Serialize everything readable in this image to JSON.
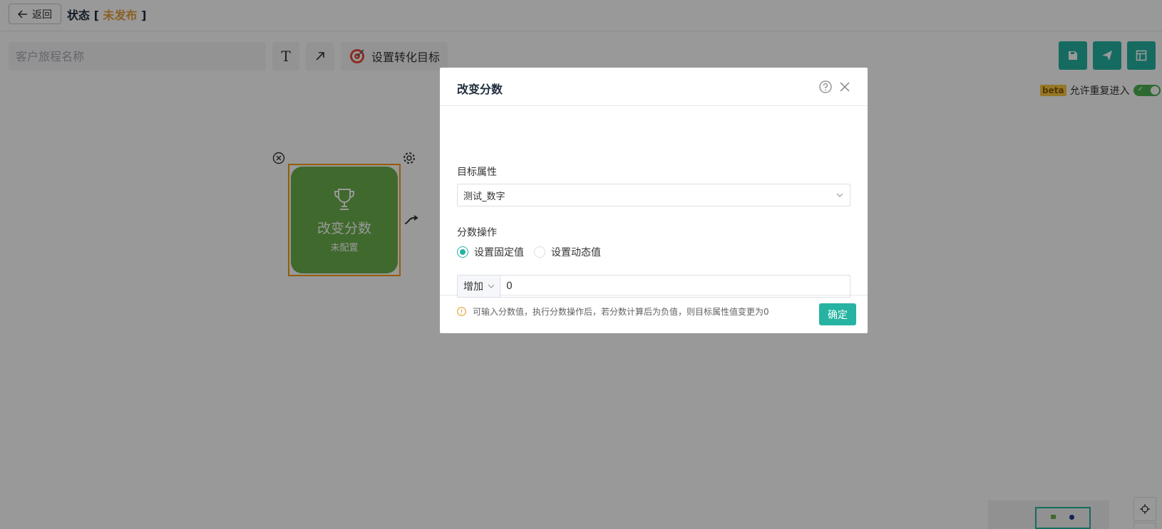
{
  "header": {
    "back_label": "返回",
    "status_prefix": "状态 [",
    "status_value": "未发布",
    "status_suffix": "]"
  },
  "toolbar": {
    "name_placeholder": "客户旅程名称",
    "text_tool_glyph": "T",
    "goal_label": "设置转化目标"
  },
  "settings": {
    "beta_label": "beta",
    "allow_reentry_label": "允许重复进入",
    "allow_reentry_enabled": true
  },
  "node": {
    "title": "改变分数",
    "subtitle": "未配置"
  },
  "dialog": {
    "title": "改变分数",
    "attr_label": "目标属性",
    "attr_value": "测试_数字",
    "op_label": "分数操作",
    "radio_fixed": "设置固定值",
    "radio_dynamic": "设置动态值",
    "selected_radio": "fixed",
    "op_select_value": "增加",
    "score_value": "0",
    "hint": "可输入分数值，执行分数操作后，若分数计算后为负值，则目标属性值变更为0",
    "ok_label": "确定"
  },
  "colors": {
    "accent": "#26b3a2",
    "warning": "#e6a23c",
    "node_fill": "#6ab04c",
    "node_border": "#f39c12"
  }
}
